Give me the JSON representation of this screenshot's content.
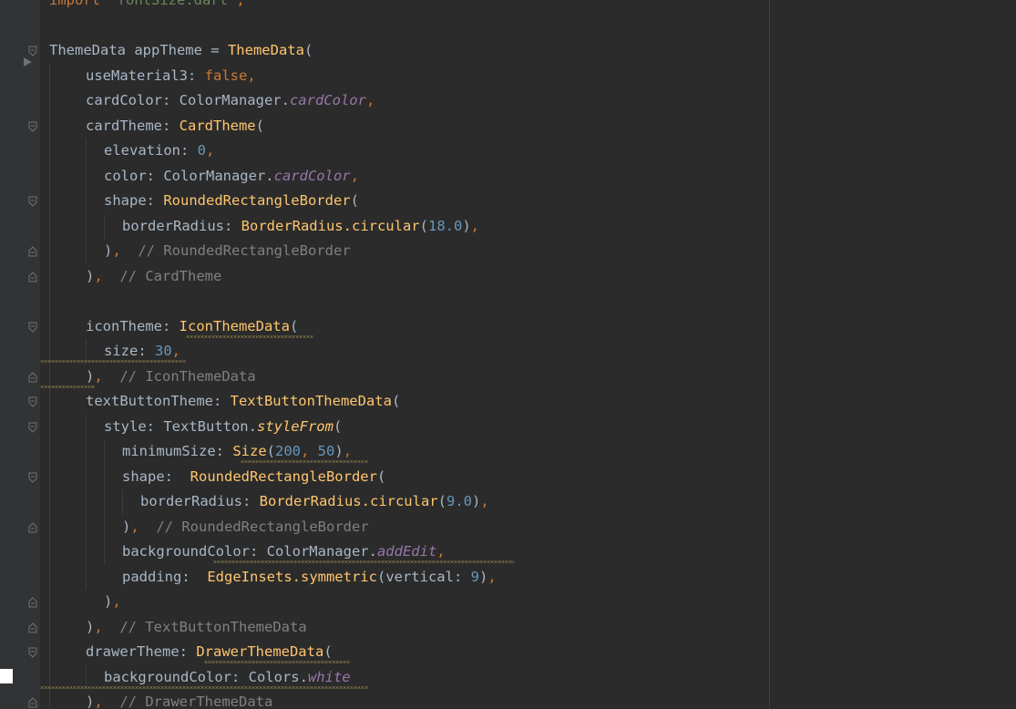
{
  "editor": {
    "colors": {
      "background": "#2b2b2b",
      "keyword": "#cc7832",
      "class": "#ffc66d",
      "number": "#6897bb",
      "string": "#6a8759",
      "comment": "#808080",
      "field": "#9876aa",
      "identifier": "#a9b7c6"
    },
    "lines": [
      {
        "indent": 0,
        "tokens": [
          {
            "t": "import ",
            "c": "kw"
          },
          {
            "t": "'fontSize.dart'",
            "c": "str"
          },
          {
            "t": ";",
            "c": "kw"
          }
        ]
      },
      {
        "indent": 0,
        "tokens": []
      },
      {
        "indent": 0,
        "tokens": [
          {
            "t": "ThemeData appTheme = ",
            "c": "id"
          },
          {
            "t": "ThemeData",
            "c": "cls"
          },
          {
            "t": "(",
            "c": "id"
          }
        ]
      },
      {
        "indent": 2,
        "tokens": [
          {
            "t": "useMaterial3: ",
            "c": "id"
          },
          {
            "t": "false",
            "c": "kw"
          },
          {
            "t": ",",
            "c": "kw"
          }
        ]
      },
      {
        "indent": 2,
        "tokens": [
          {
            "t": "cardColor: ColorManager.",
            "c": "id"
          },
          {
            "t": "cardColor",
            "c": "fld"
          },
          {
            "t": ",",
            "c": "kw"
          }
        ]
      },
      {
        "indent": 2,
        "tokens": [
          {
            "t": "cardTheme: ",
            "c": "id"
          },
          {
            "t": "CardTheme",
            "c": "cls"
          },
          {
            "t": "(",
            "c": "id"
          }
        ]
      },
      {
        "indent": 3,
        "tokens": [
          {
            "t": "elevation: ",
            "c": "id"
          },
          {
            "t": "0",
            "c": "num"
          },
          {
            "t": ",",
            "c": "kw"
          }
        ]
      },
      {
        "indent": 3,
        "tokens": [
          {
            "t": "color: ColorManager.",
            "c": "id"
          },
          {
            "t": "cardColor",
            "c": "fld"
          },
          {
            "t": ",",
            "c": "kw"
          }
        ]
      },
      {
        "indent": 3,
        "tokens": [
          {
            "t": "shape: ",
            "c": "id"
          },
          {
            "t": "RoundedRectangleBorder",
            "c": "cls"
          },
          {
            "t": "(",
            "c": "id"
          }
        ]
      },
      {
        "indent": 4,
        "tokens": [
          {
            "t": "borderRadius: ",
            "c": "id"
          },
          {
            "t": "BorderRadius.",
            "c": "cls"
          },
          {
            "t": "circular",
            "c": "fn"
          },
          {
            "t": "(",
            "c": "id"
          },
          {
            "t": "18.0",
            "c": "num"
          },
          {
            "t": ")",
            "c": "id"
          },
          {
            "t": ",",
            "c": "kw"
          }
        ]
      },
      {
        "indent": 3,
        "tokens": [
          {
            "t": ")",
            "c": "id"
          },
          {
            "t": ",",
            "c": "kw"
          },
          {
            "t": "  // RoundedRectangleBorder",
            "c": "cmt"
          }
        ]
      },
      {
        "indent": 2,
        "tokens": [
          {
            "t": ")",
            "c": "id"
          },
          {
            "t": ",",
            "c": "kw"
          },
          {
            "t": "  // CardTheme",
            "c": "cmt"
          }
        ]
      },
      {
        "indent": 0,
        "tokens": []
      },
      {
        "indent": 2,
        "tokens": [
          {
            "t": "iconTheme: ",
            "c": "id"
          },
          {
            "t": "IconThemeData",
            "c": "cls"
          },
          {
            "t": "(",
            "c": "id"
          }
        ]
      },
      {
        "indent": 3,
        "tokens": [
          {
            "t": "size: ",
            "c": "id"
          },
          {
            "t": "30",
            "c": "num"
          },
          {
            "t": ",",
            "c": "kw"
          }
        ]
      },
      {
        "indent": 2,
        "tokens": [
          {
            "t": ")",
            "c": "id"
          },
          {
            "t": ",",
            "c": "kw"
          },
          {
            "t": "  // IconThemeData",
            "c": "cmt"
          }
        ]
      },
      {
        "indent": 2,
        "tokens": [
          {
            "t": "textButtonTheme: ",
            "c": "id"
          },
          {
            "t": "TextButtonThemeData",
            "c": "cls"
          },
          {
            "t": "(",
            "c": "id"
          }
        ]
      },
      {
        "indent": 3,
        "tokens": [
          {
            "t": "style: TextButton.",
            "c": "id"
          },
          {
            "t": "styleFrom",
            "c": "fn-i"
          },
          {
            "t": "(",
            "c": "id"
          }
        ]
      },
      {
        "indent": 4,
        "tokens": [
          {
            "t": "minimumSize: ",
            "c": "id"
          },
          {
            "t": "Size",
            "c": "cls"
          },
          {
            "t": "(",
            "c": "id"
          },
          {
            "t": "200",
            "c": "num"
          },
          {
            "t": ", ",
            "c": "kw"
          },
          {
            "t": "50",
            "c": "num"
          },
          {
            "t": ")",
            "c": "id"
          },
          {
            "t": ",",
            "c": "kw"
          }
        ]
      },
      {
        "indent": 4,
        "tokens": [
          {
            "t": "shape:  ",
            "c": "id"
          },
          {
            "t": "RoundedRectangleBorder",
            "c": "cls"
          },
          {
            "t": "(",
            "c": "id"
          }
        ]
      },
      {
        "indent": 5,
        "tokens": [
          {
            "t": "borderRadius: ",
            "c": "id"
          },
          {
            "t": "BorderRadius.",
            "c": "cls"
          },
          {
            "t": "circular",
            "c": "fn"
          },
          {
            "t": "(",
            "c": "id"
          },
          {
            "t": "9.0",
            "c": "num"
          },
          {
            "t": ")",
            "c": "id"
          },
          {
            "t": ",",
            "c": "kw"
          }
        ]
      },
      {
        "indent": 4,
        "tokens": [
          {
            "t": ")",
            "c": "id"
          },
          {
            "t": ",",
            "c": "kw"
          },
          {
            "t": "  // RoundedRectangleBorder",
            "c": "cmt"
          }
        ]
      },
      {
        "indent": 4,
        "tokens": [
          {
            "t": "backgroundColor: ColorManager.",
            "c": "id"
          },
          {
            "t": "addEdit",
            "c": "fld"
          },
          {
            "t": ",",
            "c": "kw"
          }
        ]
      },
      {
        "indent": 4,
        "tokens": [
          {
            "t": "padding:  ",
            "c": "id"
          },
          {
            "t": "EdgeInsets.",
            "c": "cls"
          },
          {
            "t": "symmetric",
            "c": "fn"
          },
          {
            "t": "(vertical: ",
            "c": "id"
          },
          {
            "t": "9",
            "c": "num"
          },
          {
            "t": ")",
            "c": "id"
          },
          {
            "t": ",",
            "c": "kw"
          }
        ]
      },
      {
        "indent": 3,
        "tokens": [
          {
            "t": ")",
            "c": "id"
          },
          {
            "t": ",",
            "c": "kw"
          }
        ]
      },
      {
        "indent": 2,
        "tokens": [
          {
            "t": ")",
            "c": "id"
          },
          {
            "t": ",",
            "c": "kw"
          },
          {
            "t": "  // TextButtonThemeData",
            "c": "cmt"
          }
        ]
      },
      {
        "indent": 2,
        "tokens": [
          {
            "t": "drawerTheme: ",
            "c": "id"
          },
          {
            "t": "DrawerThemeData",
            "c": "cls"
          },
          {
            "t": "(",
            "c": "id"
          }
        ]
      },
      {
        "indent": 3,
        "tokens": [
          {
            "t": "backgroundColor: Colors.",
            "c": "id"
          },
          {
            "t": "white",
            "c": "fld"
          }
        ]
      },
      {
        "indent": 2,
        "tokens": [
          {
            "t": ")",
            "c": "id"
          },
          {
            "t": ",",
            "c": "kw"
          },
          {
            "t": "  // DrawerThemeData",
            "c": "cmt"
          }
        ]
      }
    ]
  }
}
